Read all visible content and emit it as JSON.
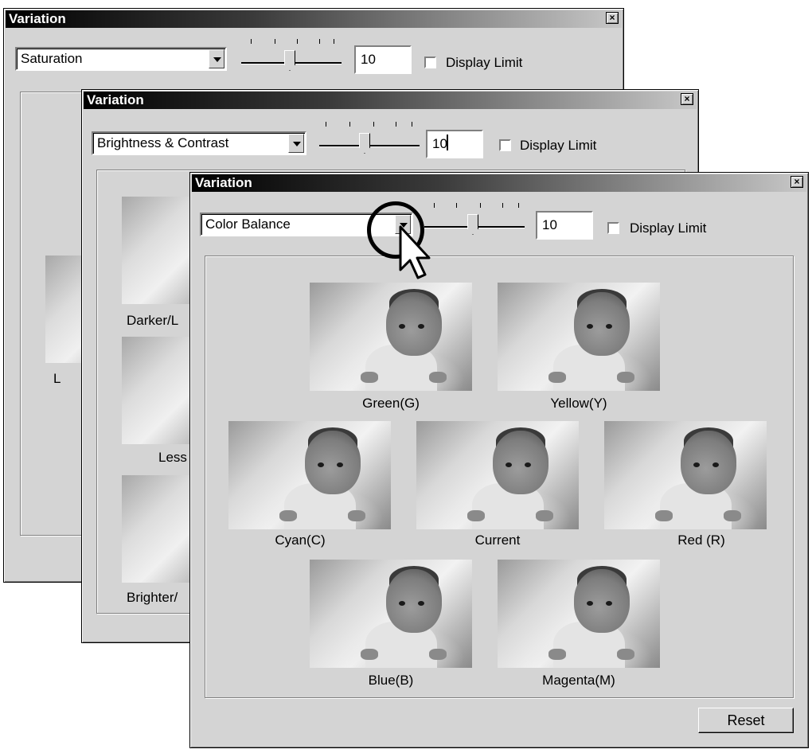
{
  "windows": {
    "back": {
      "title": "Variation",
      "close": "×",
      "dropdown_value": "Saturation",
      "amount": "10",
      "display_limit": "Display Limit",
      "partial_label": "L"
    },
    "middle": {
      "title": "Variation",
      "close": "×",
      "dropdown_value": "Brightness & Contrast",
      "amount": "10",
      "display_limit": "Display Limit",
      "captions": [
        "Darker/L",
        "Less",
        "Brighter/"
      ]
    },
    "front": {
      "title": "Variation",
      "close": "×",
      "dropdown_value": "Color Balance",
      "amount": "10",
      "display_limit": "Display Limit",
      "thumbnails": [
        {
          "label": "Green(G)"
        },
        {
          "label": "Yellow(Y)"
        },
        {
          "label": "Cyan(C)"
        },
        {
          "label": "Current"
        },
        {
          "label": "Red (R)"
        },
        {
          "label": "Blue(B)"
        },
        {
          "label": "Magenta(M)"
        }
      ],
      "reset_label": "Reset"
    }
  }
}
